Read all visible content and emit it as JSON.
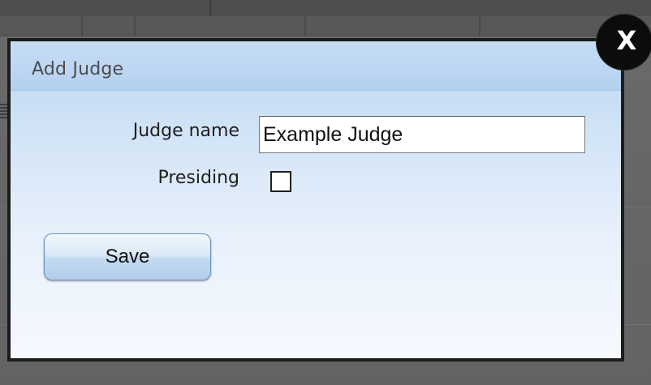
{
  "dialog": {
    "title": "Add Judge",
    "close_label": "X",
    "fields": {
      "judge_name_label": "Judge name",
      "judge_name_value": "Example Judge",
      "presiding_label": "Presiding",
      "presiding_checked": false
    },
    "save_label": "Save"
  },
  "colors": {
    "overlay": "#5f5f5f",
    "dialog_border": "#1c1c1c",
    "dialog_gradient_top": "#b7d5f2",
    "dialog_gradient_bottom": "#f6f9fe",
    "title_text": "#4c4c4c",
    "close_button": "#0c0c0c"
  },
  "icons": {
    "close": "close-icon"
  }
}
